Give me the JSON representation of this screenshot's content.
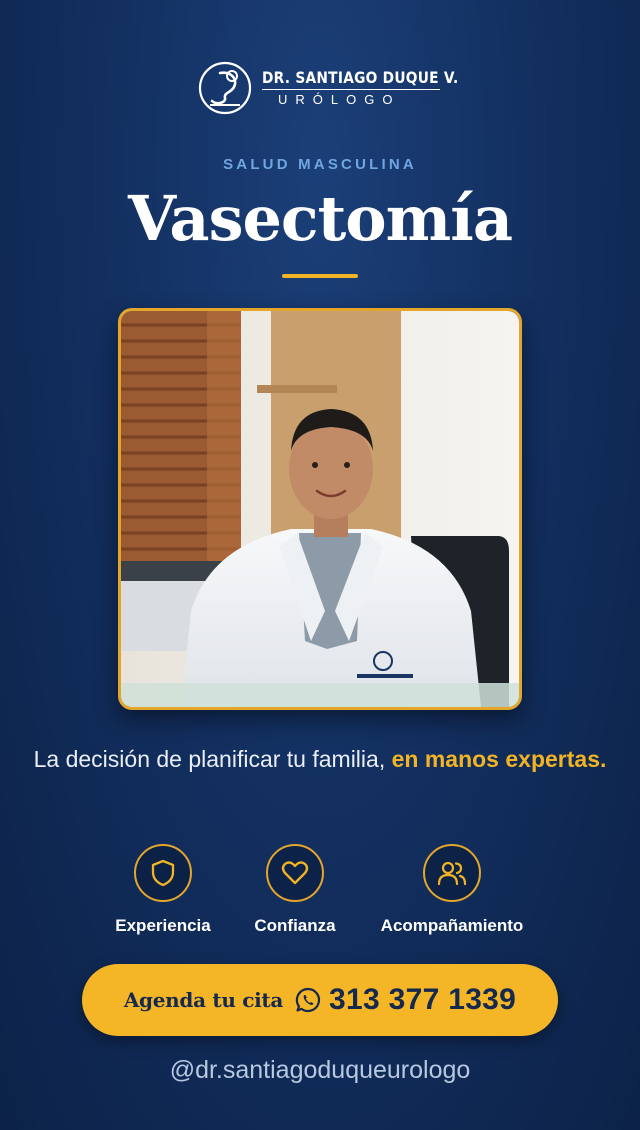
{
  "brand": {
    "name": "DR. SANTIAGO DUQUE V.",
    "specialty": "URÓLOGO",
    "logo_icon": "urology-logo-icon"
  },
  "hero": {
    "kicker": "SALUD MASCULINA",
    "title": "Vasectomía"
  },
  "photo": {
    "subject": "doctor-portrait-image"
  },
  "tagline": {
    "text": "La decisión de planificar tu familia, ",
    "highlight": "en manos expertas."
  },
  "features": [
    {
      "icon": "shield-icon",
      "label": "Experiencia"
    },
    {
      "icon": "heart-icon",
      "label": "Confianza"
    },
    {
      "icon": "users-icon",
      "label": "Acompañamiento"
    }
  ],
  "cta": {
    "label": "Agenda tu cita",
    "icon": "whatsapp-icon",
    "phone": "313 377 1339"
  },
  "social": {
    "handle": "@dr.santiagoduqueurologo"
  },
  "colors": {
    "background": "#133061",
    "accent": "#f2b324",
    "kicker": "#6fa6e2",
    "cta_text": "#15284d"
  }
}
